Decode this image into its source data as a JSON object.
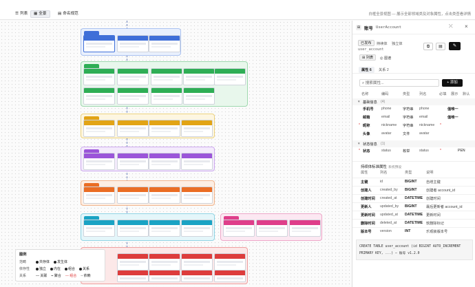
{
  "topbar": {
    "tab_list": "列表",
    "tab_full": "全景",
    "tab_naming": "命名规范",
    "hint": "白框全景视图 — 展示全部领域类及对象属性，点击类查看详情"
  },
  "legend": {
    "title": "图例",
    "scope_label": "范畴",
    "scope_items": [
      "共存体",
      "发生体"
    ],
    "dep_label": "依存性",
    "dep_items": [
      "独立",
      "内在",
      "组合",
      "关系"
    ],
    "rel_label": "关系",
    "rel_items": [
      "关联",
      "聚合",
      "组合",
      "依赖"
    ]
  },
  "panel": {
    "class_name_cn": "账号",
    "class_name_en": "UserAccount",
    "badge_published": "已发布",
    "badge_persistent": "持续体",
    "badge_independent": "独立体",
    "table_name": "user_account",
    "view_list": "列表",
    "view_graph": "图谱",
    "tab_attrs": "属性 6",
    "tab_relations": "关系 2",
    "search_placeholder": "搜索属性...",
    "add_button": "添加",
    "col_headers": [
      "名称",
      "编码",
      "类型",
      "列名",
      "必填",
      "展示",
      "默认"
    ],
    "section_basic": "基础信息",
    "section_basic_count": "(4)",
    "section_status": "状态信息",
    "section_status_count": "(1)",
    "attributes": [
      {
        "name": "手机号",
        "code": "phone",
        "type": "字符串",
        "column": "phone",
        "req": "",
        "extra": "值唯一"
      },
      {
        "name": "邮箱",
        "code": "email",
        "type": "字符串",
        "column": "email",
        "req": "",
        "extra": "值唯一"
      },
      {
        "name": "昵称",
        "code": "nickname",
        "type": "字符串",
        "column": "nickname",
        "req": "*",
        "extra": ""
      },
      {
        "name": "头像",
        "code": "avatar",
        "type": "文件",
        "column": "avatar",
        "req": "",
        "extra": ""
      }
    ],
    "status_attr": {
      "name": "状态",
      "code": "status",
      "type": "枚举",
      "column": "status",
      "req": "*",
      "extra": "PEN"
    },
    "inherit_title": "持续体标准属性",
    "inherit_sub": "系统预设",
    "inherit_headers": [
      "属性",
      "列名",
      "类型",
      "说明"
    ],
    "inherit_rows": [
      {
        "attr": "主键",
        "col": "id",
        "type": "BIGINT",
        "desc": "自增主键"
      },
      {
        "attr": "创建人",
        "col": "created_by",
        "type": "BIGINT",
        "desc": "创建者 account_id"
      },
      {
        "attr": "创建时间",
        "col": "created_at",
        "type": "DATETIME",
        "desc": "创建时间"
      },
      {
        "attr": "更新人",
        "col": "updated_by",
        "type": "BIGINT",
        "desc": "最后更新者 account_id"
      },
      {
        "attr": "更新时间",
        "col": "updated_at",
        "type": "DATETIME",
        "desc": "更新时间"
      },
      {
        "attr": "删除时间",
        "col": "deleted_at",
        "type": "DATETIME",
        "desc": "软删除标记"
      },
      {
        "attr": "版本号",
        "col": "version",
        "type": "INT",
        "desc": "乐观锁版本号"
      }
    ],
    "ddl_line1": "CREATE TABLE user_account (id BIGINT AUTO_INCREMENT",
    "ddl_line2": "PRIMARY KEY, ...) — 账号 v1.2.0"
  },
  "colors": {
    "blue": "#3f6fd8",
    "green": "#2eae55",
    "yellow": "#e2a416",
    "purple": "#9b55d9",
    "orange": "#ea6d24",
    "cyan": "#1aa3c4",
    "pink": "#df3e8a",
    "red": "#dd3c3c"
  }
}
